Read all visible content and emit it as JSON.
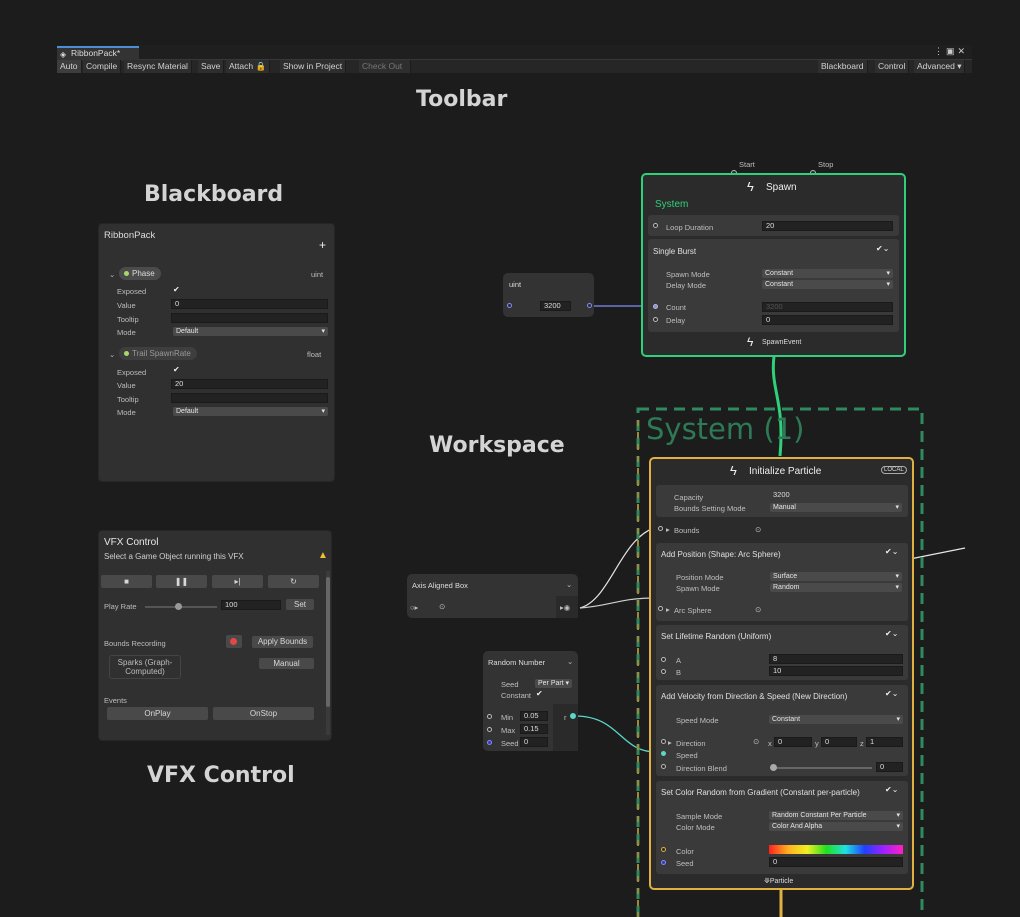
{
  "captions": {
    "toolbar": "Toolbar",
    "blackboard": "Blackboard",
    "workspace": "Workspace",
    "vfx_control": "VFX Control"
  },
  "window": {
    "tab_title": "RibbonPack*"
  },
  "toolbar": {
    "auto": "Auto",
    "compile": "Compile",
    "resync": "Resync Material",
    "save": "Save",
    "attach": "Attach",
    "show_in_project": "Show in Project",
    "check_out": "Check Out",
    "blackboard": "Blackboard",
    "control": "Control",
    "advanced": "Advanced"
  },
  "blackboard": {
    "title": "RibbonPack",
    "add": "+",
    "properties": [
      {
        "name": "Phase",
        "type": "uint",
        "exposed_label": "Exposed",
        "value_label": "Value",
        "value": "0",
        "tooltip_label": "Tooltip",
        "mode_label": "Mode",
        "mode": "Default"
      },
      {
        "name": "Trail SpawnRate",
        "type": "float",
        "exposed_label": "Exposed",
        "value_label": "Value",
        "value": "20",
        "tooltip_label": "Tooltip",
        "mode_label": "Mode",
        "mode": "Default"
      }
    ]
  },
  "vfx_control": {
    "title": "VFX Control",
    "subtitle": "Select a Game Object running this VFX",
    "play_rate_label": "Play Rate",
    "play_rate": "100",
    "set": "Set",
    "bounds_recording": "Bounds Recording",
    "apply_bounds": "Apply Bounds",
    "sparks": "Sparks (Graph-Computed)",
    "manual": "Manual",
    "events": "Events",
    "on_play": "OnPlay",
    "on_stop": "OnStop"
  },
  "spawn": {
    "start": "Start",
    "stop": "Stop",
    "title": "Spawn",
    "system": "System",
    "loop_duration_label": "Loop Duration",
    "loop_duration": "20",
    "burst_title": "Single Burst",
    "spawn_mode_label": "Spawn Mode",
    "spawn_mode": "Constant",
    "delay_mode_label": "Delay Mode",
    "delay_mode": "Constant",
    "count_label": "Count",
    "count": "3200",
    "delay_label": "Delay",
    "delay": "0",
    "event": "SpawnEvent"
  },
  "uint_node": {
    "title": "uint",
    "value": "3200"
  },
  "system_label": "System (1)",
  "init": {
    "title": "Initialize Particle",
    "badge": "LOCAL",
    "capacity_label": "Capacity",
    "capacity": "3200",
    "bounds_mode_label": "Bounds Setting Mode",
    "bounds_mode": "Manual",
    "bounds_label": "Bounds",
    "add_position": {
      "title": "Add Position (Shape: Arc Sphere)",
      "position_mode_label": "Position Mode",
      "position_mode": "Surface",
      "spawn_mode_label": "Spawn Mode",
      "spawn_mode": "Random",
      "arc_sphere": "Arc Sphere"
    },
    "lifetime": {
      "title": "Set Lifetime Random (Uniform)",
      "a_label": "A",
      "a": "8",
      "b_label": "B",
      "b": "10"
    },
    "velocity": {
      "title": "Add Velocity from Direction & Speed (New Direction)",
      "speed_mode_label": "Speed Mode",
      "speed_mode": "Constant",
      "direction_label": "Direction",
      "x": "0",
      "y": "0",
      "z": "1",
      "speed_label": "Speed",
      "direction_blend_label": "Direction Blend",
      "direction_blend": "0"
    },
    "color": {
      "title": "Set Color Random from Gradient (Constant per-particle)",
      "sample_mode_label": "Sample Mode",
      "sample_mode": "Random Constant Per Particle",
      "color_mode_label": "Color Mode",
      "color_mode": "Color And Alpha",
      "color_label": "Color",
      "seed_label": "Seed",
      "seed": "0"
    },
    "particle": "Particle"
  },
  "aabox": {
    "title": "Axis Aligned Box"
  },
  "random_number": {
    "title": "Random Number",
    "seed_label": "Seed",
    "seed_mode": "Per Part",
    "constant_label": "Constant",
    "min_label": "Min",
    "min": "0.05",
    "max_label": "Max",
    "max": "0.15",
    "seed2_label": "Seed",
    "seed2": "0",
    "out": "r"
  },
  "colors": {
    "spawn_border": "#2fd07a",
    "init_border": "#e0b040",
    "system_dash": "#2f8a5e",
    "wire_event": "#2fd07a",
    "wire_float": "#5cd6c8",
    "wire_uint": "#7f8cff"
  }
}
